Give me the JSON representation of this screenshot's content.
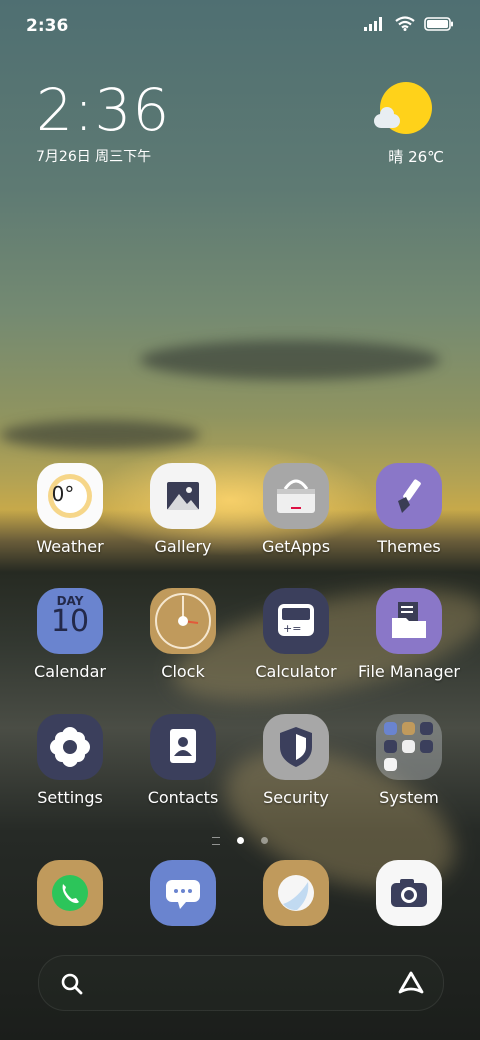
{
  "status": {
    "time": "2:36"
  },
  "lockwidget": {
    "time": "2:36",
    "date": "7月26日 周三下午",
    "weather": "晴 26℃"
  },
  "apps": [
    {
      "label": "Weather",
      "icon": "weather-icon",
      "badge": "0°"
    },
    {
      "label": "Gallery",
      "icon": "gallery-icon"
    },
    {
      "label": "GetApps",
      "icon": "getapps-icon"
    },
    {
      "label": "Themes",
      "icon": "themes-icon"
    },
    {
      "label": "Calendar",
      "icon": "calendar-icon",
      "day_word": "DAY",
      "day_num": "10"
    },
    {
      "label": "Clock",
      "icon": "clock-icon"
    },
    {
      "label": "Calculator",
      "icon": "calculator-icon"
    },
    {
      "label": "File Manager",
      "icon": "file-manager-icon"
    },
    {
      "label": "Settings",
      "icon": "settings-icon"
    },
    {
      "label": "Contacts",
      "icon": "contacts-icon"
    },
    {
      "label": "Security",
      "icon": "security-icon"
    },
    {
      "label": "System",
      "icon": "folder-icon"
    }
  ],
  "dock": [
    {
      "icon": "phone-icon"
    },
    {
      "icon": "messaging-icon"
    },
    {
      "icon": "browser-icon"
    },
    {
      "icon": "camera-icon"
    }
  ],
  "colors": {
    "tan": "#c09a5c",
    "navy": "#3b3f5c",
    "purple": "#8a77c8",
    "blue": "#6a84cf",
    "gray": "#a7a7a7"
  }
}
